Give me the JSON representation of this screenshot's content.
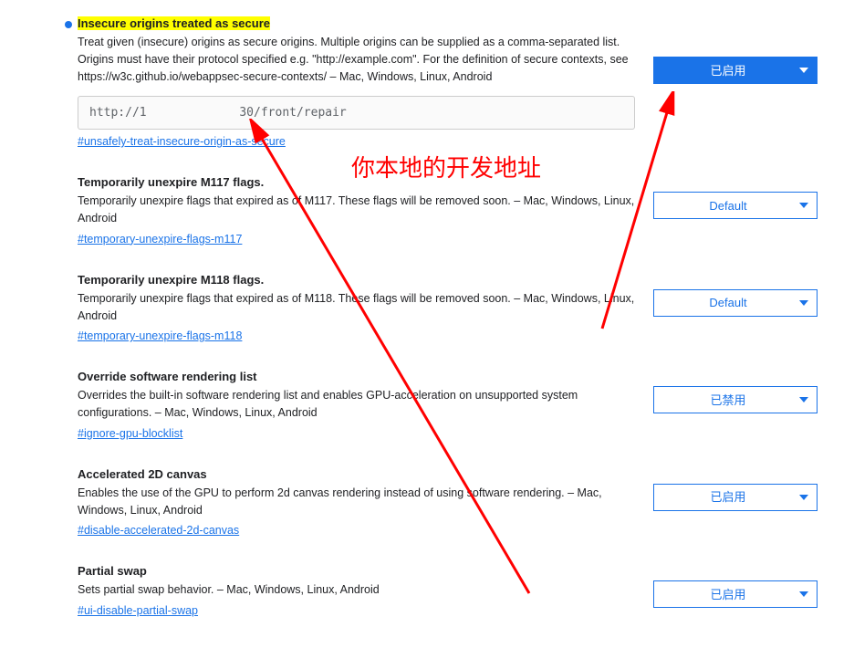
{
  "annotation": {
    "text": "你本地的开发地址"
  },
  "flags": [
    {
      "title": "Insecure origins treated as secure",
      "highlighted": true,
      "dot": true,
      "desc": "Treat given (insecure) origins as secure origins. Multiple origins can be supplied as a comma-separated list. Origins must have their protocol specified e.g. \"http://example.com\". For the definition of secure contexts, see https://w3c.github.io/webappsec-secure-contexts/ – Mac, Windows, Linux, Android",
      "input_value": "http://1             30/front/repair",
      "link": "#unsafely-treat-insecure-origin-as-secure",
      "select_value": "已启用",
      "select_style": "filled",
      "side_pad": "normal"
    },
    {
      "title": "Temporarily unexpire M117 flags.",
      "desc": "Temporarily unexpire flags that expired as of M117. These flags will be removed soon. – Mac, Windows, Linux, Android",
      "link": "#temporary-unexpire-flags-m117",
      "select_value": "Default",
      "select_style": "outline",
      "side_pad": "short"
    },
    {
      "title": "Temporarily unexpire M118 flags.",
      "desc": "Temporarily unexpire flags that expired as of M118. These flags will be removed soon. – Mac, Windows, Linux, Android",
      "link": "#temporary-unexpire-flags-m118",
      "select_value": "Default",
      "select_style": "outline",
      "side_pad": "short"
    },
    {
      "title": "Override software rendering list",
      "desc": "Overrides the built-in software rendering list and enables GPU-acceleration on unsupported system configurations. – Mac, Windows, Linux, Android",
      "link": "#ignore-gpu-blocklist",
      "select_value": "已禁用",
      "select_style": "outline",
      "side_pad": "short"
    },
    {
      "title": "Accelerated 2D canvas",
      "desc": "Enables the use of the GPU to perform 2d canvas rendering instead of using software rendering. – Mac, Windows, Linux, Android",
      "link": "#disable-accelerated-2d-canvas",
      "select_value": "已启用",
      "select_style": "outline",
      "side_pad": "short"
    },
    {
      "title": "Partial swap",
      "desc": "Sets partial swap behavior. – Mac, Windows, Linux, Android",
      "link": "#ui-disable-partial-swap",
      "select_value": "已启用",
      "select_style": "outline",
      "side_pad": "short"
    }
  ]
}
